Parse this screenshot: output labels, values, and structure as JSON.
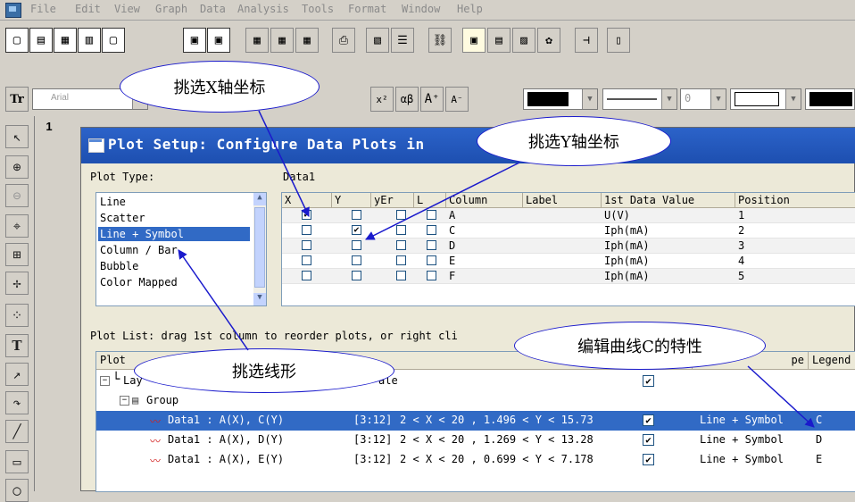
{
  "menu": [
    "File",
    "Edit",
    "View",
    "Graph",
    "Data",
    "Analysis",
    "Tools",
    "Format",
    "Window",
    "Help"
  ],
  "font_combo": "Arial",
  "font_icon": "Tr",
  "format_buttons": [
    "x²",
    "αβ",
    "A⁺",
    "A⁻"
  ],
  "fontsize_value": "0",
  "worksheet_number": "1",
  "dialog": {
    "title": "Plot Setup: Configure Data Plots in",
    "plot_type_label": "Plot Type:",
    "dataset_label": "Data1",
    "plot_types": [
      "Line",
      "Scatter",
      "Line + Symbol",
      "Column / Bar",
      "Bubble",
      "Color Mapped"
    ],
    "selected_plot_type_index": 2,
    "grid_headers": [
      "X",
      "Y",
      "yEr",
      "L",
      "Column",
      "Label",
      "1st Data Value",
      "Position"
    ],
    "grid_rows": [
      {
        "x": true,
        "y": false,
        "yer": false,
        "l": false,
        "column": "A",
        "label": "",
        "first": "U(V)",
        "position": "1"
      },
      {
        "x": false,
        "y": true,
        "yer": false,
        "l": false,
        "column": "C",
        "label": "",
        "first": "Iph(mA)",
        "position": "2"
      },
      {
        "x": false,
        "y": false,
        "yer": false,
        "l": false,
        "column": "D",
        "label": "",
        "first": "Iph(mA)",
        "position": "3"
      },
      {
        "x": false,
        "y": false,
        "yer": false,
        "l": false,
        "column": "E",
        "label": "",
        "first": "Iph(mA)",
        "position": "4"
      },
      {
        "x": false,
        "y": false,
        "yer": false,
        "l": false,
        "column": "F",
        "label": "",
        "first": "Iph(mA)",
        "position": "5"
      }
    ],
    "plot_list_label": "Plot List: drag 1st column to reorder plots, or right cli",
    "plot_headers": {
      "plot": "Plot",
      "type": "pe",
      "legend": "Legend"
    },
    "layer_row": "Lay",
    "layer_suffix": "ale",
    "group_row": "Group",
    "plots": [
      {
        "name": "Data1 : A(X), C(Y)",
        "range": "[3:12]",
        "limits": "2 < X < 20 , 1.496 < Y < 15.73",
        "checked": true,
        "type": "Line + Symbol",
        "legend": "C"
      },
      {
        "name": "Data1 : A(X), D(Y)",
        "range": "[3:12]",
        "limits": "2 < X < 20 , 1.269 < Y < 13.28",
        "checked": true,
        "type": "Line + Symbol",
        "legend": "D"
      },
      {
        "name": "Data1 : A(X), E(Y)",
        "range": "[3:12]",
        "limits": "2 < X < 20 , 0.699 < Y < 7.178",
        "checked": true,
        "type": "Line + Symbol",
        "legend": "E"
      }
    ]
  },
  "callouts": {
    "select_x": "挑选X轴坐标",
    "select_y": "挑选Y轴坐标",
    "select_line": "挑选线形",
    "edit_curve": "编辑曲线C的特性"
  },
  "colors": {
    "title_bar": "#1d4fb0",
    "selection": "#316ac5",
    "callout_border": "#1a1acc",
    "arrow": "#1a1acc"
  }
}
